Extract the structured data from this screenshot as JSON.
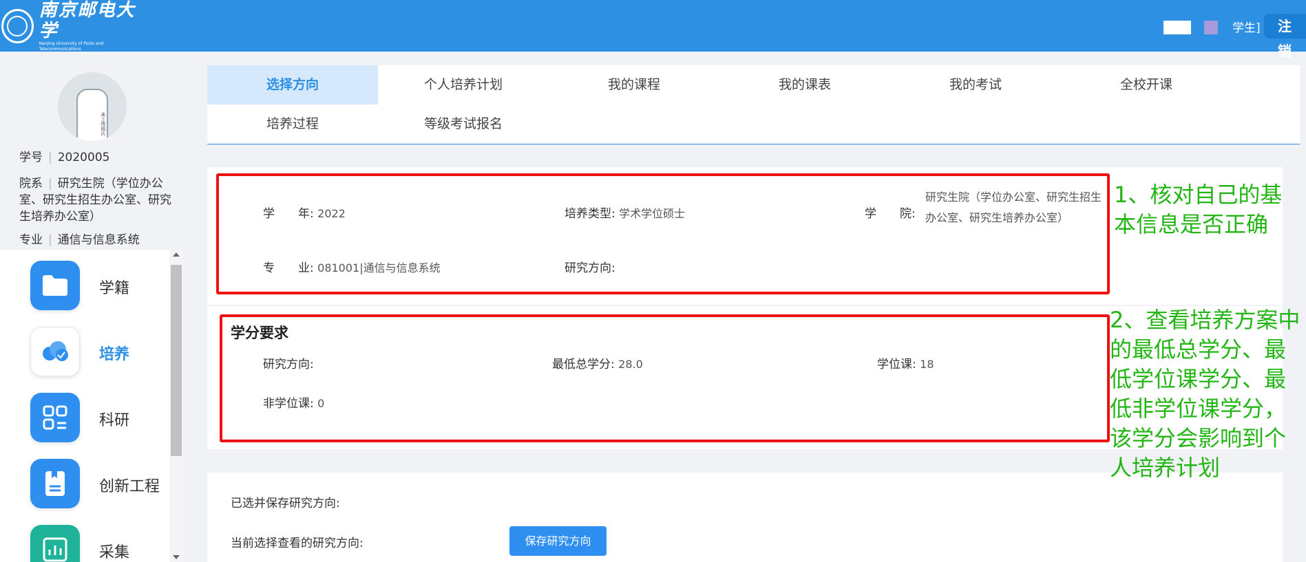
{
  "header": {
    "logo_cn": "南京邮电大学",
    "logo_en": "Nanjing University of Posts and Telecommunications",
    "user_role": "学生]",
    "logout_label": "注 销"
  },
  "profile": {
    "student_id_label": "学号",
    "student_id": "2020005",
    "college_label": "院系",
    "college": "研究生院（学位办公室、研究生招生办公室、研究生培养办公室）",
    "major_label": "专业",
    "major": "通信与信息系统",
    "avatar_text": "未上传照片"
  },
  "menu": {
    "items": [
      {
        "label": "学籍",
        "icon": "folder-icon"
      },
      {
        "label": "培养",
        "icon": "cloud-icon"
      },
      {
        "label": "科研",
        "icon": "qrcode-icon"
      },
      {
        "label": "创新工程",
        "icon": "document-icon"
      },
      {
        "label": "采集",
        "icon": "chart-icon"
      }
    ]
  },
  "tabs": [
    {
      "label": "选择方向",
      "active": true
    },
    {
      "label": "个人培养计划"
    },
    {
      "label": "我的课程"
    },
    {
      "label": "我的课表"
    },
    {
      "label": "我的考试"
    },
    {
      "label": "全校开课"
    },
    {
      "label": "培养过程"
    },
    {
      "label": "等级考试报名"
    }
  ],
  "basic_info": {
    "year_label": "学　　年:",
    "year": "2022",
    "type_label": "培养类型:",
    "type": "学术学位硕士",
    "college_label": "学　　院:",
    "college": "研究生院（学位办公室、研究生招生办公室、研究生培养办公室）",
    "major_label": "专　　业:",
    "major": "081001|通信与信息系统",
    "direction_label": "研究方向:",
    "direction": ""
  },
  "credits": {
    "title": "学分要求",
    "direction_label": "研究方向:",
    "direction": "",
    "min_total_label": "最低总学分:",
    "min_total": "28.0",
    "degree_label": "学位课:",
    "degree": "18",
    "non_degree_label": "非学位课:",
    "non_degree": "0"
  },
  "selection": {
    "saved_label": "已选并保存研究方向:",
    "current_label": "当前选择查看的研究方向:",
    "save_button": "保存研究方向"
  },
  "annotations": {
    "note1": "1、核对自己的基本信息是否正确",
    "note2": "2、查看培养方案中的最低总学分、最低学位课学分、最低非学位课学分，该学分会影响到个人培养计划"
  },
  "colors": {
    "header": "#2d90e3",
    "active_tab_bg": "#d6e9fc",
    "annotation_box": "#ee1111",
    "annotation_text": "#22b514",
    "button": "#2f8ff0"
  }
}
